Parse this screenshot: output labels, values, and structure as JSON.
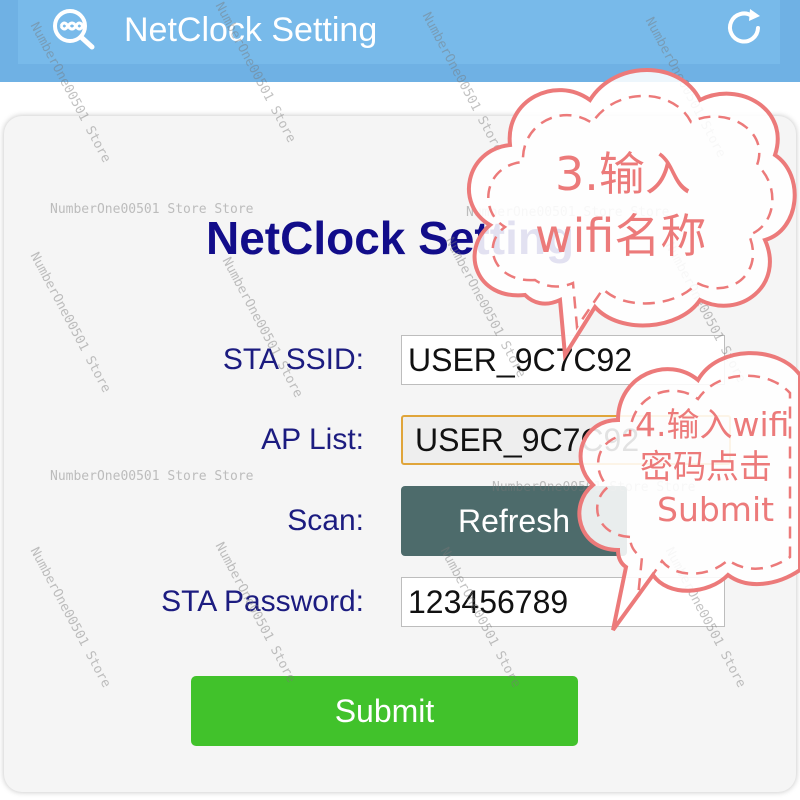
{
  "app_bar": {
    "title": "NetClock Setting",
    "logo_icon": "link-search-icon",
    "refresh_icon": "refresh-icon",
    "color": "#6fb1e4"
  },
  "form": {
    "title": "NetClock Setting",
    "ssid": {
      "label": "STA SSID:",
      "value": "USER_9C7C92"
    },
    "ap_list": {
      "label": "AP List:",
      "selected": "USER_9C7C92"
    },
    "scan": {
      "label": "Scan:",
      "button": "Refresh"
    },
    "password": {
      "label": "STA Password:",
      "value": "123456789"
    },
    "submit": "Submit",
    "title_color": "#120d8a",
    "submit_color": "#41c22b",
    "refresh_color": "#4d6b6b"
  },
  "annotations": {
    "step3_line1": "3.输入",
    "step3_line2": "wifi名称",
    "step4_line1": "4.输入wifi",
    "step4_line2": "密码点击",
    "step4_line3": "Submit",
    "color": "#ec7a7a"
  },
  "watermark": {
    "store": "NumberOne00501 Store Store",
    "diagonal": "NumberOne00501 Store"
  }
}
